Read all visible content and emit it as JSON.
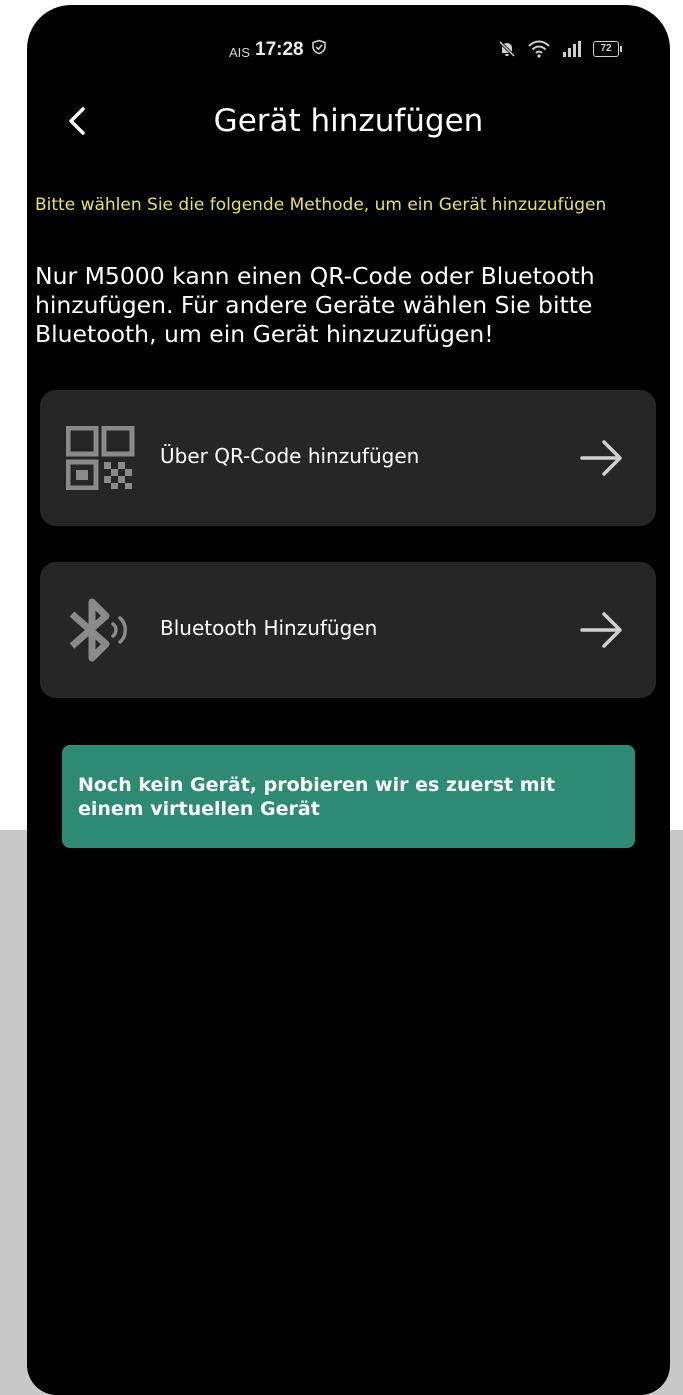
{
  "status_bar": {
    "carrier": "AIS",
    "time": "17:28",
    "battery": "72",
    "icons": [
      "check-circle-icon",
      "mute-bell-icon",
      "wifi-icon",
      "signal-icon",
      "battery-icon"
    ]
  },
  "header": {
    "title": "Gerät hinzufügen",
    "back_icon": "chevron-left-icon"
  },
  "hint": "Bitte wählen Sie die folgende Methode, um ein Gerät hinzuzufügen",
  "description": "Nur M5000 kann einen QR-Code oder Bluetooth hinzufügen. Für andere Geräte wählen Sie bitte Bluetooth, um ein Gerät hinzuzufügen!",
  "options": [
    {
      "label": "Über QR-Code hinzufügen",
      "icon": "qr-code-icon"
    },
    {
      "label": "Bluetooth Hinzufügen",
      "icon": "bluetooth-icon"
    }
  ],
  "virtual_device": "Noch kein Gerät, probieren wir es zuerst mit einem virtuellen Gerät",
  "colors": {
    "background": "#000000",
    "card": "#262626",
    "hint": "#e6e35a",
    "accent": "#2e8b73"
  }
}
